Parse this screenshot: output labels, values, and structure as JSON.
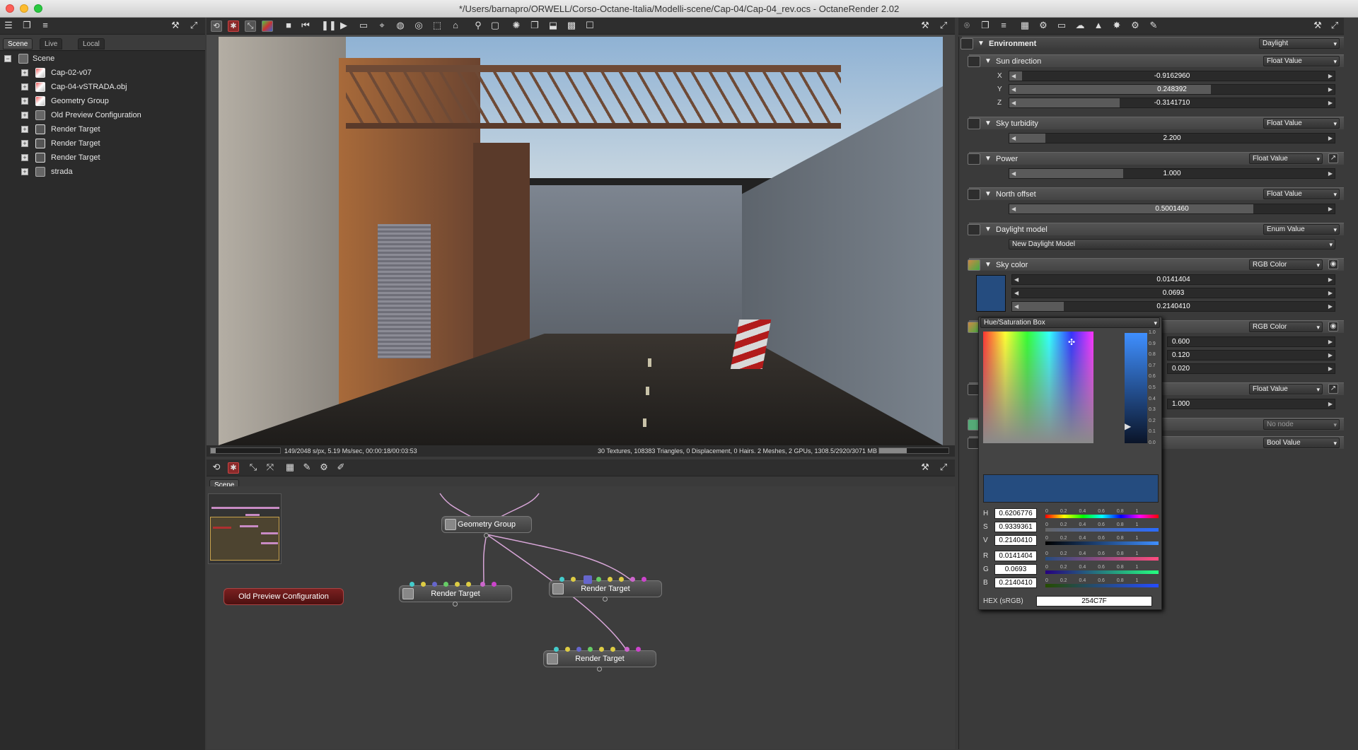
{
  "window": {
    "title": "*/Users/barnapro/ORWELL/Corso-Octane-Italia/Modelli-scene/Cap-04/Cap-04_rev.ocs - OctaneRender 2.02"
  },
  "scene_tabs": [
    "Scene",
    "Live DB",
    "Local DB"
  ],
  "scene_tree": {
    "root": "Scene",
    "items": [
      "Cap-02-v07",
      "Cap-04-vSTRADA.obj",
      "Geometry Group",
      "Old Preview Configuration",
      "Render Target",
      "Render Target",
      "Render Target",
      "strada"
    ]
  },
  "render_status": {
    "left": "149/2048 s/px, 5.19 Ms/sec, 00:00:18/00:03:53",
    "right": "30 Textures, 108383 Triangles, 0 Displacement, 0 Hairs. 2 Meshes, 2 GPUs, 1308.5/2920/3071 MB",
    "progress": 0.073
  },
  "graph": {
    "tab": "Scene",
    "nodes": {
      "geometry_group": "Geometry Group",
      "render_target_1": "Render Target",
      "render_target_2": "Render Target",
      "render_target_3": "Render Target",
      "old_preview": "Old Preview Configuration"
    }
  },
  "inspector": {
    "environment": {
      "label": "Environment",
      "type": "Daylight"
    },
    "sun_direction": {
      "label": "Sun direction",
      "type": "Float Value",
      "x": "-0.9162960",
      "y": "0.248392",
      "z": "-0.3141710",
      "x_fill": 0.04,
      "y_fill": 0.62,
      "z_fill": 0.34
    },
    "sky_turbidity": {
      "label": "Sky turbidity",
      "type": "Float Value",
      "value": "2.200",
      "fill": 0.11
    },
    "power": {
      "label": "Power",
      "type": "Float Value",
      "value": "1.000",
      "fill": 0.35
    },
    "north_offset": {
      "label": "North offset",
      "type": "Float Value",
      "value": "0.5001460",
      "fill": 0.75
    },
    "daylight_model": {
      "label": "Daylight model",
      "type": "Enum Value",
      "value": "New Daylight Model"
    },
    "sky_color": {
      "label": "Sky color",
      "type": "RGB Color",
      "r": "0.0141404",
      "g": "0.0693",
      "b": "0.2140410",
      "swatch": "#254c7f"
    },
    "sunset_color": {
      "type": "RGB Color",
      "r": "0.600",
      "g": "0.120",
      "b": "0.020"
    },
    "sun_size": {
      "type": "Float Value",
      "value": "1.000"
    },
    "texture": {
      "value": "No node"
    },
    "bool": {
      "type": "Bool Value"
    },
    "axis_labels": [
      "X",
      "Y",
      "Z"
    ]
  },
  "color_picker": {
    "mode": "Hue/Saturation Box",
    "v_ticks": [
      "1.0",
      "0.9",
      "0.8",
      "0.7",
      "0.6",
      "0.5",
      "0.4",
      "0.3",
      "0.2",
      "0.1",
      "0.0"
    ],
    "scale_ticks": "0 0.2 0.4 0.6 0.8 1",
    "h": {
      "label": "H",
      "value": "0.6206776"
    },
    "s": {
      "label": "S",
      "value": "0.9339361"
    },
    "v": {
      "label": "V",
      "value": "0.2140410"
    },
    "r": {
      "label": "R",
      "value": "0.0141404"
    },
    "g": {
      "label": "G",
      "value": "0.0693"
    },
    "b": {
      "label": "B",
      "value": "0.2140410"
    },
    "hex_label": "HEX (sRGB)",
    "hex": "254C7F",
    "preview_color": "#254c7f"
  }
}
